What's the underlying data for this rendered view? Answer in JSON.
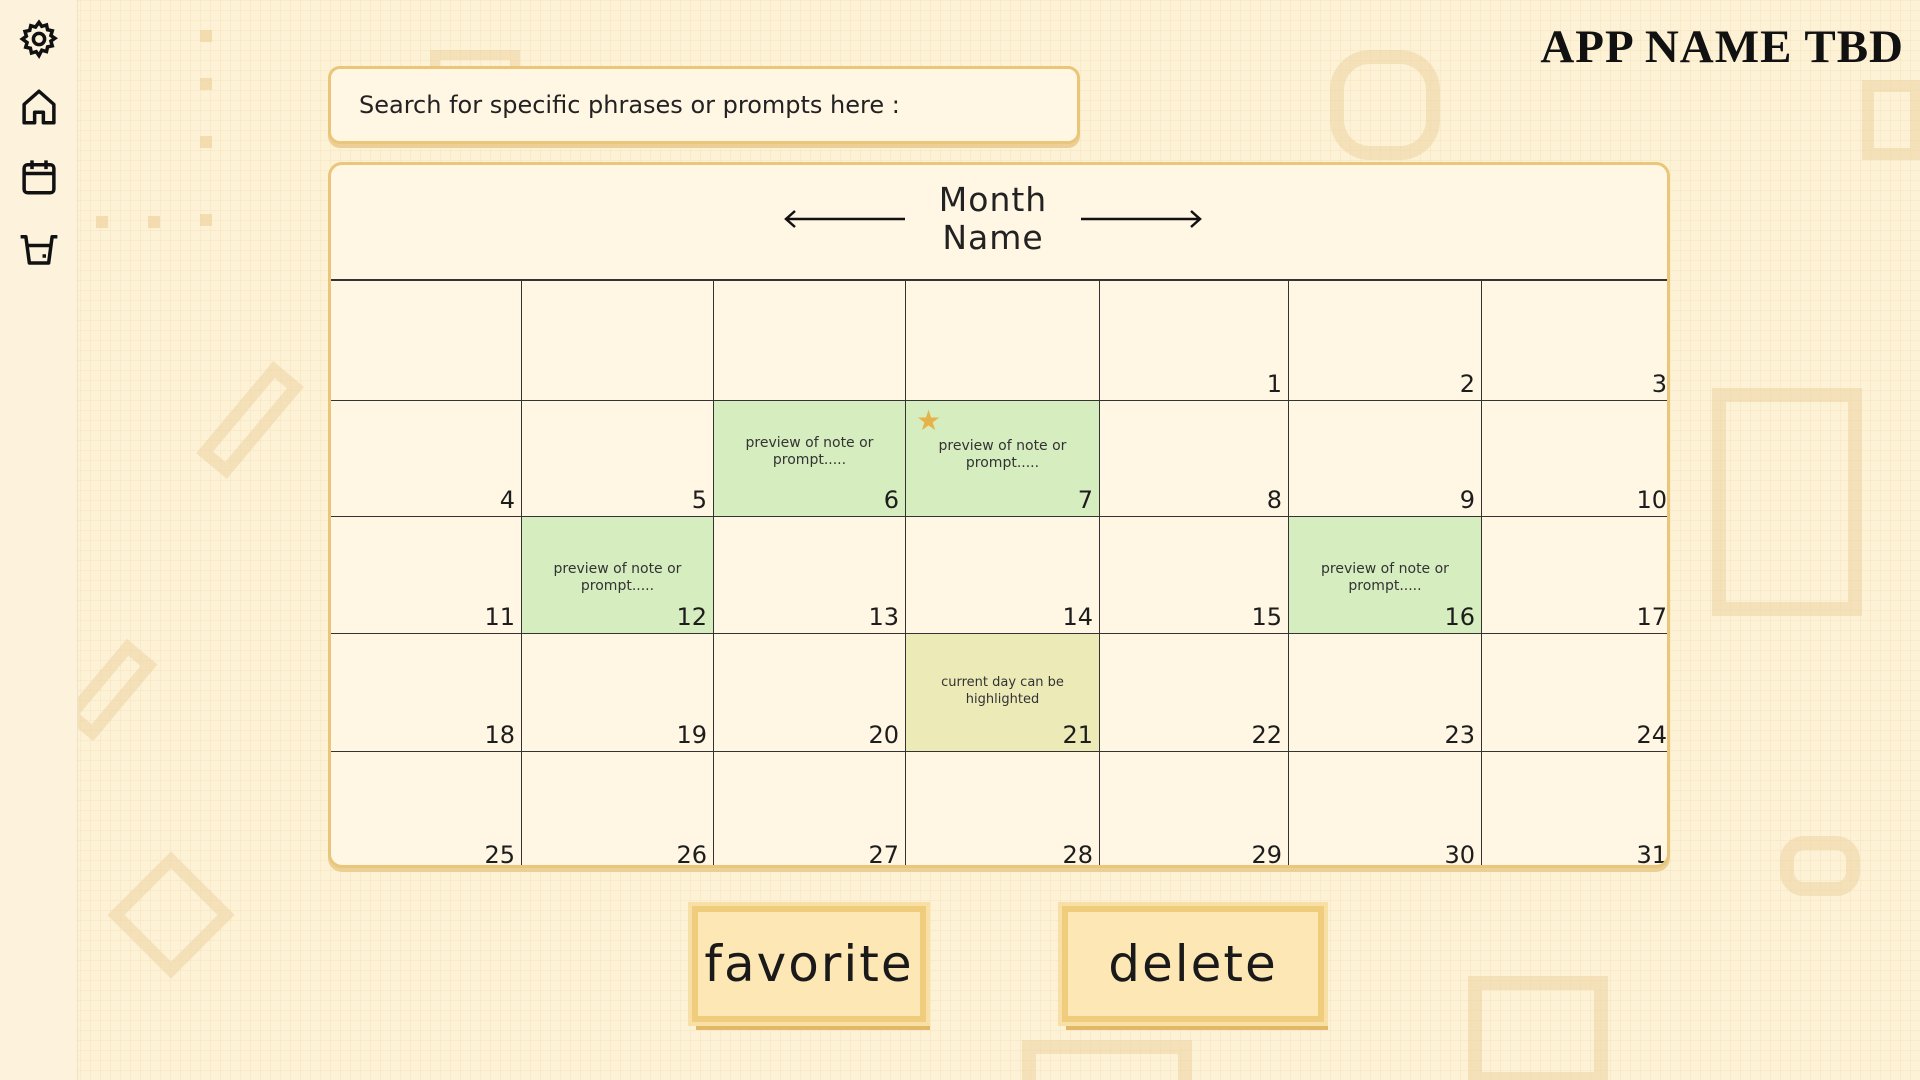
{
  "app": {
    "title": "APP NAME TBD"
  },
  "sidebar": {
    "items": [
      {
        "icon": "gear-icon"
      },
      {
        "icon": "home-icon"
      },
      {
        "icon": "calendar-icon"
      },
      {
        "icon": "basket-icon"
      }
    ]
  },
  "search": {
    "placeholder": "Search for specific phrases or prompts here :"
  },
  "calendar": {
    "month_line1": "Month",
    "month_line2": "Name",
    "days": {
      "d1": "1",
      "d2": "2",
      "d3": "3",
      "d4": "4",
      "d5": "5",
      "d6": "6",
      "d7": "7",
      "d8": "8",
      "d9": "9",
      "d10": "10",
      "d11": "11",
      "d12": "12",
      "d13": "13",
      "d14": "14",
      "d15": "15",
      "d16": "16",
      "d17": "17",
      "d18": "18",
      "d19": "19",
      "d20": "20",
      "d21": "21",
      "d22": "22",
      "d23": "23",
      "d24": "24",
      "d25": "25",
      "d26": "26",
      "d27": "27",
      "d28": "28",
      "d29": "29",
      "d30": "30",
      "d31": "31"
    },
    "notes": {
      "d6": "preview of note or prompt.....",
      "d7": "preview of note or prompt.....",
      "d12": "preview of note or prompt.....",
      "d16": "preview of note or prompt....."
    },
    "today_text": "current day can be highlighted",
    "favorited_day": "7",
    "colors": {
      "note": "#d5edbf",
      "today": "#ecebb8",
      "accent": "#e9c67a",
      "star": "#e6b34a"
    }
  },
  "actions": {
    "favorite_label": "favorite",
    "delete_label": "delete"
  }
}
